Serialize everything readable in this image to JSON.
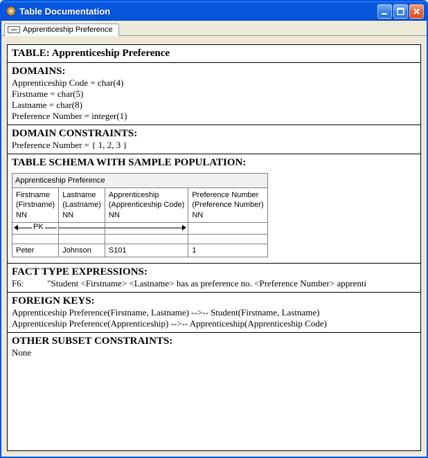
{
  "window": {
    "title": "Table Documentation"
  },
  "tabs": {
    "active": "Apprenticeship Preference"
  },
  "table_section": {
    "heading": "TABLE: Apprenticeship Preference"
  },
  "domains": {
    "heading": "DOMAINS:",
    "lines": [
      "Apprenticeship Code = char(4)",
      "Firstname = char(5)",
      "Lastname = char(8)",
      "Preference Number = integer(1)"
    ]
  },
  "domain_constraints": {
    "heading": "DOMAIN CONSTRAINTS:",
    "line": "Preference Number = { 1, 2, 3 }"
  },
  "schema": {
    "heading": "TABLE SCHEMA WITH SAMPLE POPULATION:",
    "caption": "Apprenticeship Preference",
    "pk_label": "PK",
    "columns": [
      {
        "name": "Firstname",
        "domain": "(Firstname)",
        "nn": "NN"
      },
      {
        "name": "Lastname",
        "domain": "(Lastname)",
        "nn": "NN"
      },
      {
        "name": "Apprenticeship",
        "domain": "(Apprenticeship Code)",
        "nn": "NN"
      },
      {
        "name": "Preference Number",
        "domain": "(Preference Number)",
        "nn": "NN"
      }
    ],
    "row": [
      "Peter",
      "Johnson",
      "S101",
      "1"
    ]
  },
  "fact_types": {
    "heading": "FACT TYPE EXPRESSIONS:",
    "id": "F6:",
    "text": "\"Student <Firstname> <Lastname> has as preference no. <Preference Number> apprenti"
  },
  "foreign_keys": {
    "heading": "FOREIGN KEYS:",
    "lines": [
      "Apprenticeship Preference(Firstname, Lastname) -->-- Student(Firstname, Lastname)",
      "Apprenticeship Preference(Apprenticeship) -->-- Apprenticeship(Apprenticeship Code)"
    ]
  },
  "subset_constraints": {
    "heading": "OTHER SUBSET CONSTRAINTS:",
    "text": "None"
  }
}
